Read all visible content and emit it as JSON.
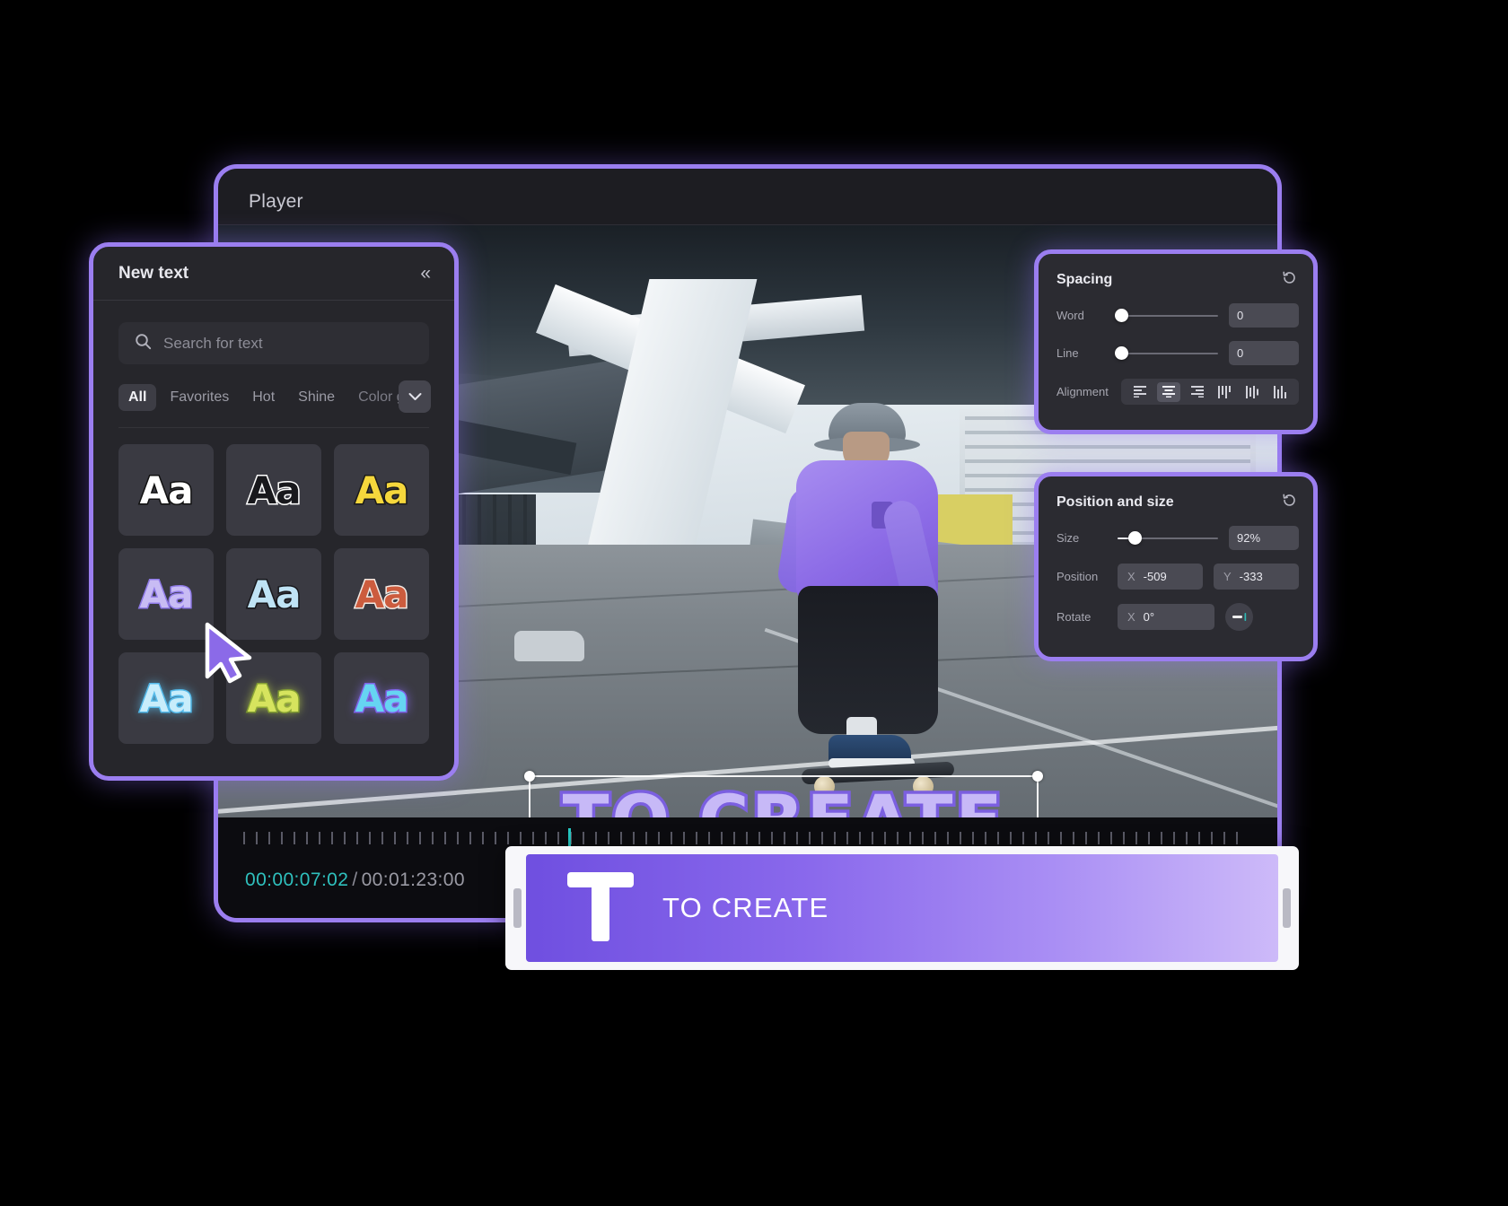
{
  "editor": {
    "player_title": "Player",
    "timeline": {
      "current_time": "00:00:07:02",
      "separator": "/",
      "total_time": "00:01:23:00"
    },
    "overlay_text": "TO CREATE"
  },
  "new_text_panel": {
    "title": "New text",
    "collapse_icon": "chevron-double-left-icon",
    "search": {
      "placeholder": "Search for text",
      "value": "",
      "icon": "search-icon"
    },
    "tabs": [
      {
        "label": "All",
        "active": true
      },
      {
        "label": "Favorites",
        "active": false
      },
      {
        "label": "Hot",
        "active": false
      },
      {
        "label": "Shine",
        "active": false
      },
      {
        "label": "Color g",
        "active": false
      }
    ],
    "more_icon": "chevron-down-icon",
    "tiles": [
      {
        "label": "Aa",
        "style": "white-black-outline"
      },
      {
        "label": "Aa",
        "style": "black-white-outline"
      },
      {
        "label": "Aa",
        "style": "yellow-black-outline"
      },
      {
        "label": "Aa",
        "style": "lavender-purple-outline"
      },
      {
        "label": "Aa",
        "style": "lightblue-black-outline"
      },
      {
        "label": "Aa",
        "style": "red-white-outline"
      },
      {
        "label": "Aa",
        "style": "cyan-glow"
      },
      {
        "label": "Aa",
        "style": "yellowgreen-glow"
      },
      {
        "label": "Aa",
        "style": "blue-purple-glow"
      }
    ]
  },
  "spacing_panel": {
    "title": "Spacing",
    "reset_icon": "reset-icon",
    "rows": [
      {
        "label": "Word",
        "value": "0",
        "slider_pct": 4
      },
      {
        "label": "Line",
        "value": "0",
        "slider_pct": 4
      }
    ],
    "alignment": {
      "label": "Alignment",
      "options": [
        "align-left-icon",
        "align-center-icon",
        "align-right-icon",
        "align-vertical-top-icon",
        "align-vertical-center-icon",
        "align-vertical-bottom-icon"
      ],
      "active_index": 1
    }
  },
  "position_panel": {
    "title": "Position and size",
    "reset_icon": "reset-icon",
    "size": {
      "label": "Size",
      "value": "92%",
      "slider_pct": 17
    },
    "position": {
      "label": "Position",
      "x_axis": "X",
      "x_value": "-509",
      "y_axis": "Y",
      "y_value": "-333"
    },
    "rotate": {
      "label": "Rotate",
      "axis": "X",
      "value": "0°",
      "flip_icon": "flip-horizontal-icon"
    }
  },
  "clip": {
    "icon": "text-t-icon",
    "label": "TO CREATE",
    "handle_left": "trim-handle-left",
    "handle_right": "trim-handle-right"
  },
  "colors": {
    "accent": "#9b7ef0",
    "clip_gradient_start": "#6f4fe0",
    "clip_gradient_end": "#cdbaf9",
    "timecode_current": "#2fc0bd",
    "panel_bg": "#2b2b31"
  }
}
